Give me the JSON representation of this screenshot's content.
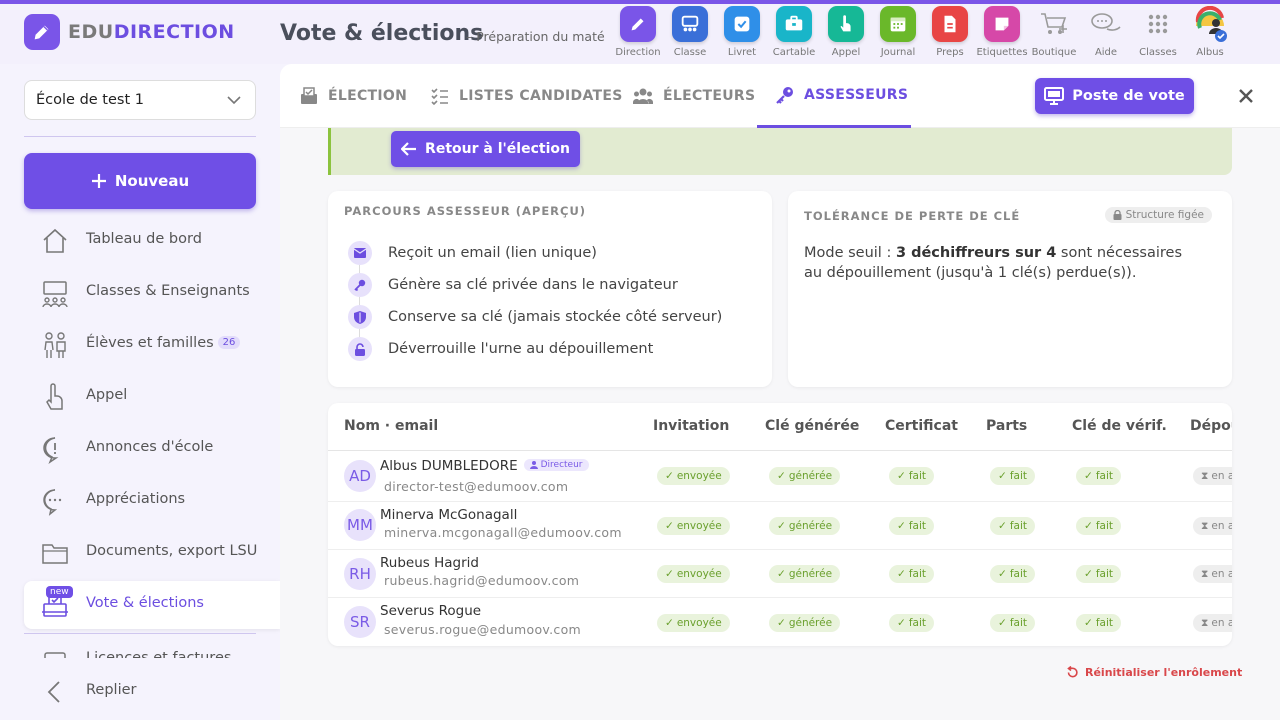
{
  "brand": {
    "logo_part1": "EDU",
    "logo_part2": "DIRECTION"
  },
  "header": {
    "title": "Vote & élections",
    "subtitle": "– Préparation du maté"
  },
  "apps": [
    {
      "label": "Direction",
      "icon": "pencil-icon",
      "color": "#7a55e8"
    },
    {
      "label": "Classe",
      "icon": "classroom-icon",
      "color": "#3a6fd8"
    },
    {
      "label": "Livret",
      "icon": "checkbox-icon",
      "color": "#2f8fe8"
    },
    {
      "label": "Cartable",
      "icon": "briefcase-icon",
      "color": "#19b5c9"
    },
    {
      "label": "Appel",
      "icon": "hand-icon",
      "color": "#16b896"
    },
    {
      "label": "Journal",
      "icon": "calendar-icon",
      "color": "#6ab82a"
    },
    {
      "label": "Preps",
      "icon": "document-icon",
      "color": "#e84545"
    },
    {
      "label": "Etiquettes",
      "icon": "sticker-icon",
      "color": "#d648a8"
    },
    {
      "label": "Boutique",
      "icon": "cart-icon",
      "color": "none"
    },
    {
      "label": "Aide",
      "icon": "chat-icon",
      "color": "none"
    },
    {
      "label": "Classes",
      "icon": "grid-icon",
      "color": "none"
    },
    {
      "label": "Albus",
      "icon": "user-avatar-icon",
      "color": "none"
    }
  ],
  "sidebar": {
    "school": "École de test 1",
    "new_button": "Nouveau",
    "items": [
      {
        "label": "Tableau de bord",
        "icon": "home-icon"
      },
      {
        "label": "Classes & Enseignants",
        "icon": "teachers-icon"
      },
      {
        "label": "Élèves et familles",
        "icon": "family-icon",
        "count": "26"
      },
      {
        "label": "Appel",
        "icon": "hand-icon"
      },
      {
        "label": "Annonces d'école",
        "icon": "announcement-icon"
      },
      {
        "label": "Appréciations",
        "icon": "comment-icon"
      },
      {
        "label": "Documents, export LSU",
        "icon": "folder-icon"
      },
      {
        "label": "Vote & élections",
        "icon": "ballot-icon",
        "badge": "new",
        "active": true
      },
      {
        "label": "Licences et factures",
        "icon": "invoice-icon"
      }
    ],
    "collapse": "Replier"
  },
  "tabs": [
    {
      "label": "ÉLECTION",
      "icon": "ballot-box-icon"
    },
    {
      "label": "LISTES CANDIDATES",
      "icon": "list-check-icon"
    },
    {
      "label": "ÉLECTEURS",
      "icon": "users-icon"
    },
    {
      "label": "ASSESSEURS",
      "icon": "key-icon",
      "active": true
    }
  ],
  "vote_station_button": "Poste de vote",
  "back_button": "Retour à l'élection",
  "journey": {
    "title": "PARCOURS ASSESSEUR (APERÇU)",
    "steps": [
      {
        "text": "Reçoit un email (lien unique)",
        "icon": "envelope-icon"
      },
      {
        "text": "Génère sa clé privée dans le navigateur",
        "icon": "key-icon"
      },
      {
        "text": "Conserve sa clé (jamais stockée côté serveur)",
        "icon": "shield-icon"
      },
      {
        "text": "Déverrouille l'urne au dépouillement",
        "icon": "unlock-icon"
      }
    ]
  },
  "tolerance": {
    "title": "TOLÉRANCE DE PERTE DE CLÉ",
    "frozen_label": "Structure figée",
    "text_before": "Mode seuil : ",
    "text_bold": "3 déchiffreurs sur 4",
    "text_after": " sont nécessaires au dépouillement (jusqu'à 1 clé(s) perdue(s))."
  },
  "table": {
    "headers": [
      "Nom · email",
      "Invitation",
      "Clé générée",
      "Certificat",
      "Parts",
      "Clé de vérif.",
      "Dépouillement"
    ],
    "rows": [
      {
        "initials": "AD",
        "name": "Albus DUMBLEDORE",
        "role": "Directeur",
        "email": "director-test@edumoov.com",
        "invitation": "envoyée",
        "key": "générée",
        "certificate": "fait",
        "parts": "fait",
        "verif": "fait",
        "count": "en attente"
      },
      {
        "initials": "MM",
        "name": "Minerva McGonagall",
        "email": "minerva.mcgonagall@edumoov.com",
        "invitation": "envoyée",
        "key": "générée",
        "certificate": "fait",
        "parts": "fait",
        "verif": "fait",
        "count": "en attente"
      },
      {
        "initials": "RH",
        "name": "Rubeus Hagrid",
        "email": "rubeus.hagrid@edumoov.com",
        "invitation": "envoyée",
        "key": "générée",
        "certificate": "fait",
        "parts": "fait",
        "verif": "fait",
        "count": "en attente"
      },
      {
        "initials": "SR",
        "name": "Severus Rogue",
        "email": "severus.rogue@edumoov.com",
        "invitation": "envoyée",
        "key": "générée",
        "certificate": "fait",
        "parts": "fait",
        "verif": "fait",
        "count": "en attente"
      }
    ]
  },
  "reset_link": "Réinitialiser l'enrôlement",
  "colors": {
    "accent": "#6f4fe6",
    "success_bg": "#e9f3dc",
    "success_text": "#6aa02d",
    "danger": "#d9474a",
    "banner_bg": "#e2ebd1"
  }
}
